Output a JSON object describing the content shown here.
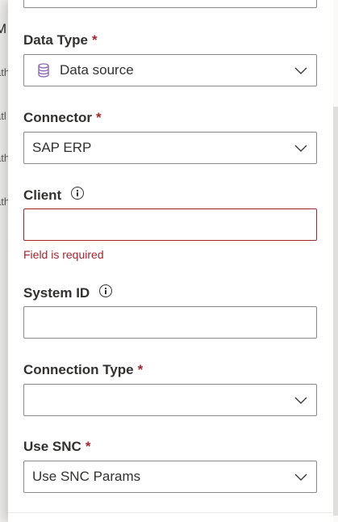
{
  "background": {
    "title_fragment": "M",
    "row_fragments": [
      "ath",
      "atl",
      "ath",
      "ath"
    ]
  },
  "form": {
    "data_type": {
      "label": "Data Type",
      "required_mark": "*",
      "value": "Data source",
      "icon": "database-icon"
    },
    "connector": {
      "label": "Connector",
      "required_mark": "*",
      "value": "SAP ERP"
    },
    "client": {
      "label": "Client",
      "value": "",
      "error": "Field is required",
      "icon": "info-icon"
    },
    "system_id": {
      "label": "System ID",
      "value": "",
      "icon": "info-icon"
    },
    "connection_type": {
      "label": "Connection Type",
      "required_mark": "*",
      "value": ""
    },
    "use_snc": {
      "label": "Use SNC",
      "required_mark": "*",
      "value": "Use SNC Params"
    }
  },
  "colors": {
    "error": "#a4262c",
    "border": "#8a8886",
    "text": "#323130",
    "icon_accent": "#8764b8"
  }
}
